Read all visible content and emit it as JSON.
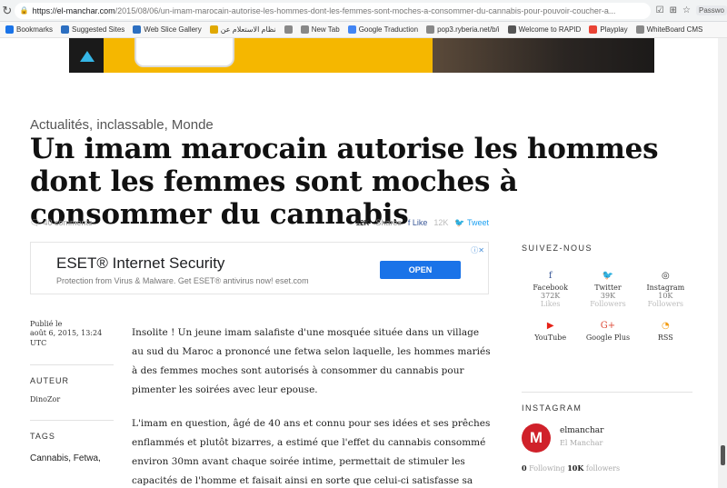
{
  "browser": {
    "url_domain": "https://el-manchar.com",
    "url_path": "/2015/08/06/un-imam-marocain-autorise-les-hommes-dont-les-femmes-sont-moches-a-consommer-du-cannabis-pour-pouvoir-coucher-a...",
    "extensions": [
      "☑",
      "⊞",
      "☆"
    ],
    "passwords_label": "Passwo",
    "bookmarks": [
      {
        "label": "Bookmarks",
        "icon": "star-icon",
        "color": "#1a73e8"
      },
      {
        "label": "Suggested Sites",
        "icon": "ie-icon",
        "color": "#2c6fc1"
      },
      {
        "label": "Web Slice Gallery",
        "icon": "ie-icon",
        "color": "#2c6fc1"
      },
      {
        "label": "نظام الاستعلام عن",
        "icon": "page-icon",
        "color": "#e0a800"
      },
      {
        "label": "",
        "icon": "globe-icon",
        "color": "#888"
      },
      {
        "label": "New Tab",
        "icon": "page-icon",
        "color": "#888"
      },
      {
        "label": "Google Traduction",
        "icon": "translate-icon",
        "color": "#4285f4"
      },
      {
        "label": "pop3.ryberia.net/b/i",
        "icon": "page-icon",
        "color": "#888"
      },
      {
        "label": "Welcome to RAPID",
        "icon": "rapid-icon",
        "color": "#555"
      },
      {
        "label": "Playplay",
        "icon": "grid-icon",
        "color": "#e94335"
      },
      {
        "label": "WhiteBoard CMS",
        "icon": "page-icon",
        "color": "#888"
      }
    ]
  },
  "article": {
    "categories": "Actualités, inclassable, Monde",
    "title": "Un imam marocain autorise les hommes dont les femmes sont moches à consommer du cannabis",
    "comments": "40 comments",
    "shares_count": "12K",
    "shares_label": "Shares",
    "like_label": "Like",
    "like_count": "12K",
    "tweet_label": "Tweet",
    "published_label": "Publié le",
    "published_date": "août 6, 2015, 13:24 UTC",
    "author_head": "AUTEUR",
    "author": "DinoZor",
    "tags_head": "TAGS",
    "tags": "Cannabis, Fetwa,",
    "paragraphs": [
      "Insolite ! Un jeune imam salafiste d'une mosquée située dans un village au sud du Maroc a prononcé une fetwa selon laquelle, les hommes mariés à des femmes moches sont autorisés à consommer du cannabis pour pimenter les soirées avec leur epouse.",
      "L'imam en question, âgé de 40 ans et connu pour ses idées et ses prêches enflammés et plutôt bizarres, a estimé que l'effet du cannabis consommé environ 30mn avant chaque soirée intime, permettait de stimuler les capacités de l'homme et faisait ainsi en sorte que celui-ci satisfasse sa"
    ]
  },
  "ad": {
    "headline": "ESET® Internet Security",
    "sub": "Protection from Virus & Malware. Get ESET® antivirus now! eset.com",
    "cta": "OPEN",
    "adchoice": "ⓘ✕"
  },
  "sidebar": {
    "follow_head": "SUIVEZ-NOUS",
    "social": [
      {
        "name": "Facebook",
        "count": "372K",
        "unit": "Likes",
        "icon": "f",
        "color": "#3b5998"
      },
      {
        "name": "Twitter",
        "count": "39K",
        "unit": "Followers",
        "icon": "🐦",
        "color": "#1da1f2"
      },
      {
        "name": "Instagram",
        "count": "10K",
        "unit": "Followers",
        "icon": "◎",
        "color": "#333"
      },
      {
        "name": "YouTube",
        "count": "",
        "unit": "",
        "icon": "▶",
        "color": "#e62117"
      },
      {
        "name": "Google Plus",
        "count": "",
        "unit": "",
        "icon": "G+",
        "color": "#dd4b39"
      },
      {
        "name": "RSS",
        "count": "",
        "unit": "",
        "icon": "◔",
        "color": "#f39c12"
      }
    ],
    "insta_head": "INSTAGRAM",
    "insta_handle": "elmanchar",
    "insta_name": "El Manchar",
    "insta_following_count": "0",
    "insta_following_label": "Following",
    "insta_followers_count": "10K",
    "insta_followers_label": "followers",
    "avatar_letter": "M"
  }
}
